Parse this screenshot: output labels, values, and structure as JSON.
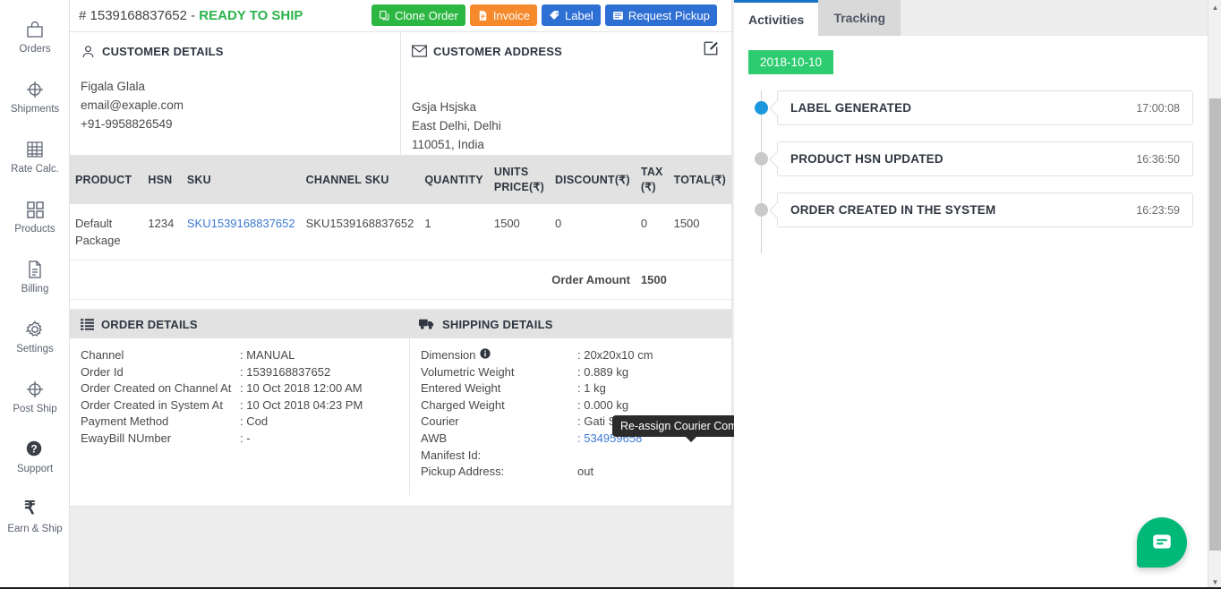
{
  "sidebar": {
    "items": [
      {
        "label": "Orders",
        "icon": "bag-icon"
      },
      {
        "label": "Shipments",
        "icon": "crosshair-icon"
      },
      {
        "label": "Rate Calc.",
        "icon": "calculator-icon"
      },
      {
        "label": "Products",
        "icon": "grid-icon"
      },
      {
        "label": "Billing",
        "icon": "document-icon"
      },
      {
        "label": "Settings",
        "icon": "gear-icon"
      },
      {
        "label": "Post Ship",
        "icon": "crosshair-icon"
      },
      {
        "label": "Support",
        "icon": "question-circle-icon"
      },
      {
        "label": "Earn & Ship",
        "icon": "rupee-icon"
      }
    ]
  },
  "order_header": {
    "order_number": "# 1539168837652 - ",
    "status": "READY TO SHIP",
    "actions": [
      {
        "label": "Clone Order",
        "color": "#2cb742",
        "icon": "copy-icon"
      },
      {
        "label": "Invoice",
        "color": "#f5892b",
        "icon": "invoice-icon"
      },
      {
        "label": "Label",
        "color": "#2e6fd4",
        "icon": "tag-icon"
      },
      {
        "label": "Request Pickup",
        "color": "#2e6fd4",
        "icon": "pickup-icon"
      }
    ]
  },
  "customer_details": {
    "heading": "CUSTOMER DETAILS",
    "name": "Figala Glala",
    "email": "email@exaple.com",
    "phone": "+91-9958826549"
  },
  "customer_address": {
    "heading": "CUSTOMER ADDRESS",
    "line1": "Gsja Hsjska",
    "line2": "East Delhi, Delhi",
    "line3": "110051, India",
    "edit_title": "Edit"
  },
  "product_table": {
    "columns": [
      "PRODUCT",
      "HSN",
      "SKU",
      "CHANNEL SKU",
      "QUANTITY",
      "UNITS PRICE(₹)",
      "DISCOUNT(₹)",
      "TAX (₹)",
      "TOTAL(₹)"
    ],
    "rows": [
      {
        "product": "Default Package",
        "hsn": "1234",
        "sku": "SKU1539168837652",
        "channel_sku": "SKU1539168837652",
        "quantity": "1",
        "units_price": "1500",
        "discount": "0",
        "tax": "0",
        "total": "1500"
      }
    ],
    "footer_label": "Order Amount",
    "footer_value": "1500"
  },
  "order_details": {
    "heading": "ORDER DETAILS",
    "rows": [
      {
        "key": "Channel",
        "value": ": MANUAL"
      },
      {
        "key": "Order Id",
        "value": ": 1539168837652"
      },
      {
        "key": "Order Created on Channel At",
        "value": ": 10 Oct 2018 12:00 AM"
      },
      {
        "key": "Order Created in System At",
        "value": ": 10 Oct 2018 04:23 PM"
      },
      {
        "key": "Payment Method",
        "value": ": Cod"
      },
      {
        "key": "EwayBill NUmber",
        "value": ": -"
      }
    ]
  },
  "shipping_details": {
    "heading": "SHIPPING DETAILS",
    "rows": [
      {
        "key": "Dimension",
        "value": ": 20x20x10 cm",
        "info": true
      },
      {
        "key": "Volumetric Weight",
        "value": ":  0.889 kg"
      },
      {
        "key": "Entered Weight",
        "value": ":  1 kg"
      },
      {
        "key": "Charged Weight",
        "value": ":  0.000 kg"
      },
      {
        "key": "Courier",
        "value": ": Gati Surface"
      },
      {
        "key": "AWB",
        "value": ": 534959658",
        "link": true
      },
      {
        "key": "Manifest Id:",
        "value": ""
      },
      {
        "key": "Pickup Address:",
        "value": "out"
      }
    ],
    "reassign_button": "Re-assign",
    "reassign_tooltip": "Re-assign Courier Company"
  },
  "activities_panel": {
    "tabs": [
      {
        "label": "Activities",
        "active": true
      },
      {
        "label": "Tracking",
        "active": false
      }
    ],
    "date_chip": "2018-10-10",
    "events": [
      {
        "title": "LABEL GENERATED",
        "time": "17:00:08",
        "active": true
      },
      {
        "title": "PRODUCT HSN UPDATED",
        "time": "16:36:50",
        "active": false
      },
      {
        "title": "ORDER CREATED IN THE SYSTEM",
        "time": "16:23:59",
        "active": false
      }
    ]
  },
  "chat": {
    "icon": "chat-bubble-icon",
    "label": "Chat"
  },
  "colors": {
    "green": "#2cb742",
    "orange": "#f5892b",
    "blue": "#2e6fd4",
    "link": "#3b79d4",
    "status_green": "#2ab34a",
    "chip_green": "#2ecc71",
    "timeline_active": "#1d97dd",
    "chat_green": "#00b878",
    "tab_border": "#1a73c4"
  }
}
